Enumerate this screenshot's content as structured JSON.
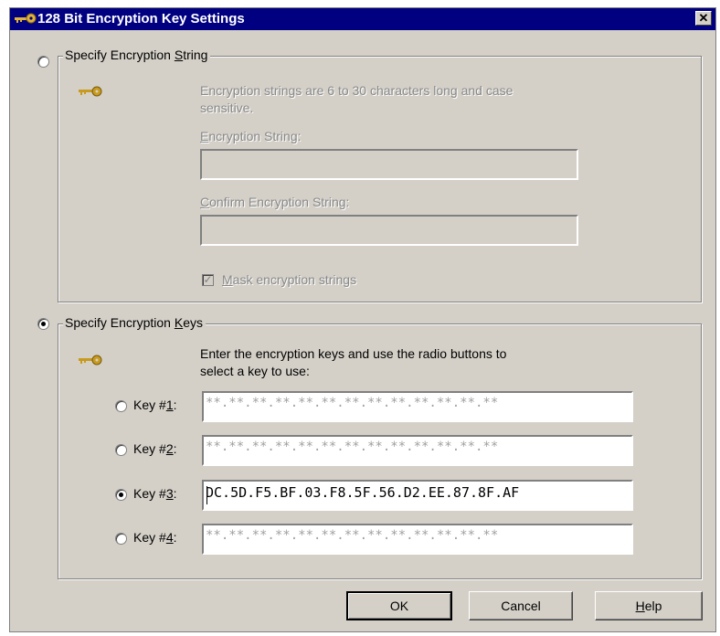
{
  "window": {
    "title": "128 Bit Encryption Key Settings",
    "close_glyph": "✕"
  },
  "string_group": {
    "legend_pre": "Specify Encryption ",
    "legend_ul": "S",
    "legend_post": "tring",
    "description_line1": "Encryption strings are 6 to 30 characters long and case",
    "description_line2": "sensitive.",
    "field1_ul": "E",
    "field1_rest": "ncryption String:",
    "field2_ul": "C",
    "field2_rest": "onfirm Encryption String:",
    "mask_ul": "M",
    "mask_rest": "ask encryption strings",
    "mask_checked": true,
    "selected": false
  },
  "keys_group": {
    "legend_pre": "Specify Encryption ",
    "legend_ul": "K",
    "legend_post": "eys",
    "description_line1": "Enter the encryption keys and use the radio buttons to",
    "description_line2": "select a key to use:",
    "selected": true,
    "keys": [
      {
        "label_pre": "Key #",
        "label_ul": "1",
        "label_post": ":",
        "value": "**.**.**.**.**.**.**.**.**.**.**.**.**",
        "selected": false
      },
      {
        "label_pre": "Key #",
        "label_ul": "2",
        "label_post": ":",
        "value": "**.**.**.**.**.**.**.**.**.**.**.**.**",
        "selected": false
      },
      {
        "label_pre": "Key #",
        "label_ul": "3",
        "label_post": ":",
        "value": "DC.5D.F5.BF.03.F8.5F.56.D2.EE.87.8F.AF",
        "selected": true
      },
      {
        "label_pre": "Key #",
        "label_ul": "4",
        "label_post": ":",
        "value": "**.**.**.**.**.**.**.**.**.**.**.**.**",
        "selected": false
      }
    ]
  },
  "buttons": {
    "ok": "OK",
    "cancel": "Cancel",
    "help_ul": "H",
    "help_rest": "elp"
  },
  "icons": {
    "key_icon": "key-icon",
    "key_color": "#c89b1e"
  },
  "colors": {
    "titlebar": "#000080",
    "face": "#d4d0c8",
    "disabled_text": "#888888"
  }
}
